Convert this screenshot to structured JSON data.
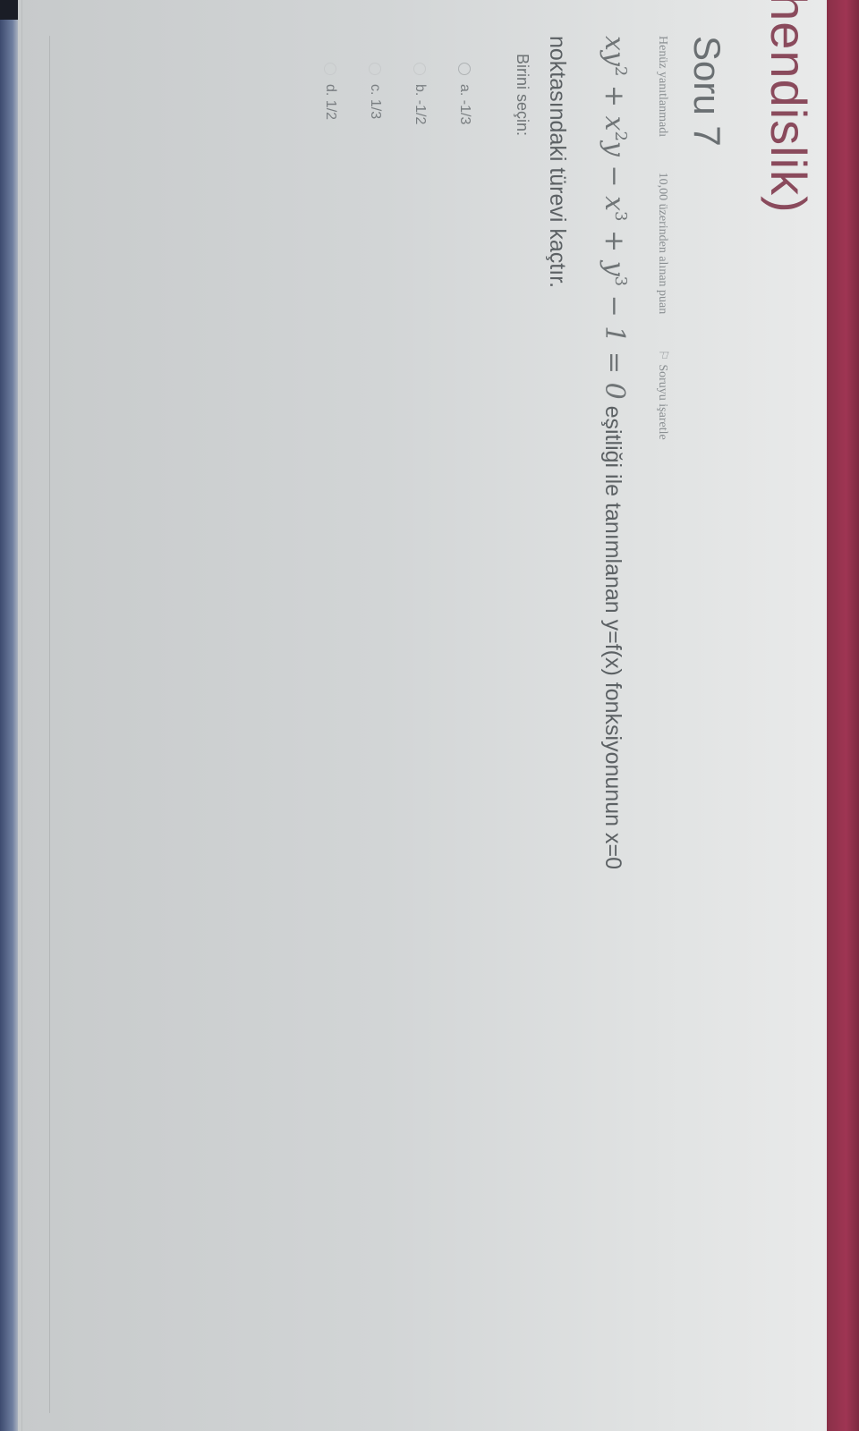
{
  "course": {
    "title_fragment": "uhendislik)"
  },
  "question": {
    "title": "Soru 7",
    "status": "Henüz yanıtlanmadı",
    "points": "10,00 üzerinden alınan puan",
    "flag_label": "Soruyu işaretle",
    "formula": {
      "t1": "xy",
      "t1_exp": "2",
      "op1": " + ",
      "t2": "x",
      "t2_exp": "2",
      "t2_rest": "y",
      "op2": " − ",
      "t3": "x",
      "t3_exp": "3",
      "op3": " + ",
      "t4": "y",
      "t4_exp": "3",
      "tail": " − 1 = 0"
    },
    "text_after_formula": "eşitliği ile tanımlanan y=f(x) fonksiyonunun x=0",
    "text_line2": "noktasındaki türevi kaçtır."
  },
  "select_label": "Birini seçin:",
  "options": [
    {
      "label": "a. -1/3"
    },
    {
      "label": "b. -1/2"
    },
    {
      "label": "c. 1/3"
    },
    {
      "label": "d. 1/2"
    }
  ],
  "colors": {
    "accent": "#8a4a5c",
    "strip": "#9f3553",
    "text": "#5c6164"
  }
}
